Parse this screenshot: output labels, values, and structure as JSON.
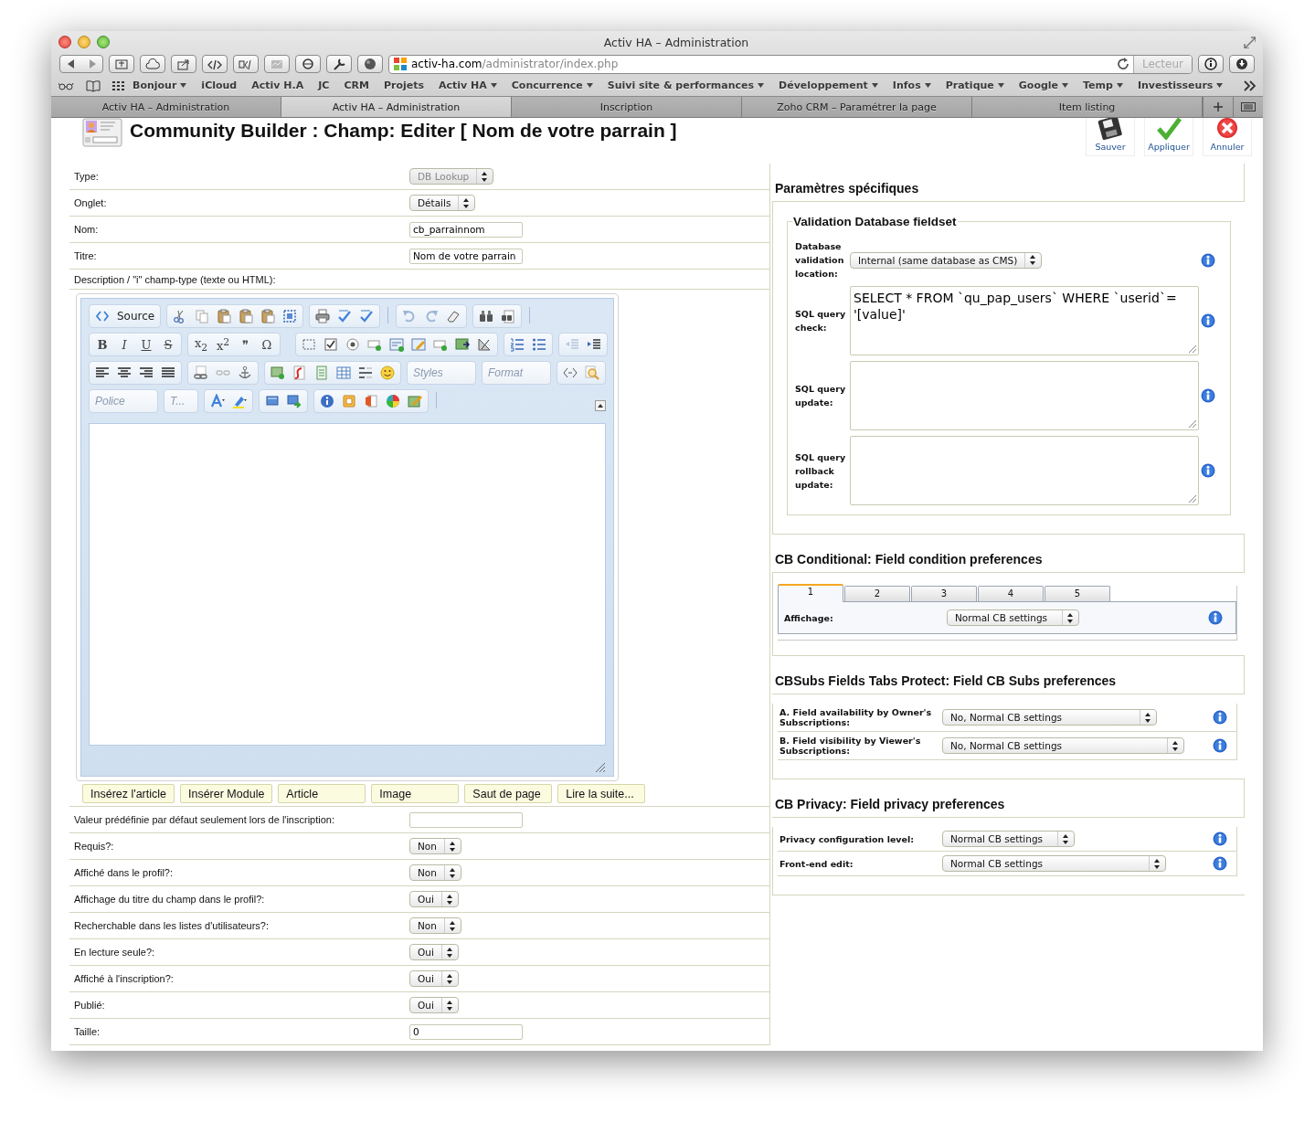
{
  "window": {
    "title": "Activ HA – Administration"
  },
  "address_bar": {
    "host": "activ-ha.com",
    "path": "/administrator/index.php",
    "reader_button": "Lecteur",
    "reader_enabled": false
  },
  "bookmarks": [
    {
      "label": "Bonjour",
      "menu": true
    },
    {
      "label": "iCloud",
      "menu": false
    },
    {
      "label": "Activ H.A",
      "menu": false
    },
    {
      "label": "JC",
      "menu": false
    },
    {
      "label": "CRM",
      "menu": false
    },
    {
      "label": "Projets",
      "menu": false
    },
    {
      "label": "Activ HA",
      "menu": true
    },
    {
      "label": "Concurrence",
      "menu": true
    },
    {
      "label": "Suivi site & performances",
      "menu": true
    },
    {
      "label": "Développement",
      "menu": true
    },
    {
      "label": "Infos",
      "menu": true
    },
    {
      "label": "Pratique",
      "menu": true
    },
    {
      "label": "Google",
      "menu": true
    },
    {
      "label": "Temp",
      "menu": true
    },
    {
      "label": "Investisseurs",
      "menu": true
    }
  ],
  "tabs": [
    {
      "label": "Activ HA – Administration",
      "selected": false
    },
    {
      "label": "Activ HA – Administration",
      "selected": true
    },
    {
      "label": "Inscription",
      "selected": false
    },
    {
      "label": "Zoho CRM – Paramétrer la page",
      "selected": false
    },
    {
      "label": "Item listing",
      "selected": false
    }
  ],
  "page": {
    "title": "Community Builder : Champ: Editer [ Nom de votre parrain ]",
    "actions": [
      {
        "label": "Sauver",
        "kind": "save"
      },
      {
        "label": "Appliquer",
        "kind": "apply"
      },
      {
        "label": "Annuler",
        "kind": "cancel"
      }
    ]
  },
  "fields": [
    {
      "label": "Type:",
      "kind": "select",
      "value": "DB Lookup",
      "disabled": true
    },
    {
      "label": "Onglet:",
      "kind": "select",
      "value": "Détails",
      "disabled": false
    },
    {
      "label": "Nom:",
      "kind": "input",
      "value": "cb_parrainnom"
    },
    {
      "label": "Titre:",
      "kind": "input",
      "value": "Nom de votre parrain"
    },
    {
      "label": "Description / \"i\" champ-type (texte ou HTML):",
      "kind": "heading"
    }
  ],
  "editor": {
    "source_label": "Source",
    "format_letters": [
      "B",
      "I",
      "U",
      "S"
    ],
    "script_buttons": [
      "x$_{2}$",
      "x$^{2}$"
    ],
    "quote_glyph": "❞",
    "omega_glyph": "Ω",
    "styles_placeholder": "Styles",
    "format_placeholder": "Format",
    "font_placeholder": "Police",
    "size_placeholder": "T...",
    "insert_buttons": [
      "Insérez l'article",
      "Insérer Module",
      "Article",
      "Image",
      "Saut de page",
      "Lire la suite..."
    ]
  },
  "fields_after": [
    {
      "label": "Valeur prédéfinie par défaut seulement lors de l'inscription:",
      "kind": "input"
    },
    {
      "label": "Requis?:",
      "kind": "select",
      "value": "Non",
      "disabled": false
    },
    {
      "label": "Affiché dans le profil?:",
      "kind": "select",
      "value": "Non",
      "disabled": false
    },
    {
      "label": "Affichage du titre du champ dans le profil?:",
      "kind": "select",
      "value": "Oui",
      "disabled": false
    },
    {
      "label": "Recherchable dans les listes d'utilisateurs?:",
      "kind": "select",
      "value": "Non",
      "disabled": false
    },
    {
      "label": "En lecture seule?:",
      "kind": "select",
      "value": "Oui",
      "disabled": false
    },
    {
      "label": "Affiché à l'inscription?:",
      "kind": "select",
      "value": "Oui",
      "disabled": false
    },
    {
      "label": "Publié:",
      "kind": "select",
      "value": "Oui",
      "disabled": false
    },
    {
      "label": "Taille:",
      "kind": "input",
      "value": "0"
    }
  ],
  "sections": [
    {
      "kind": "fieldset",
      "title": "Paramètres spécifiques",
      "legend": "Validation Database fieldset",
      "rows": [
        {
          "label": "Database validation location:",
          "kind": "select",
          "value": "Internal (same database as CMS)"
        },
        {
          "label": "SQL query check:",
          "kind": "textarea",
          "value": "SELECT * FROM `qu_pap_users` WHERE `userid`= '[value]'"
        },
        {
          "label": "SQL query update:",
          "kind": "textarea"
        },
        {
          "label": "SQL query rollback update:",
          "kind": "textarea"
        }
      ]
    },
    {
      "kind": "tabs",
      "title": "CB Conditional: Field condition preferences",
      "tabs": [
        {
          "label": "1",
          "selected": true
        },
        {
          "label": "2",
          "selected": false
        },
        {
          "label": "3",
          "selected": false
        },
        {
          "label": "4",
          "selected": false
        },
        {
          "label": "5",
          "selected": false
        }
      ],
      "rows": [
        {
          "label": "Affichage:",
          "kind": "select",
          "value": "Normal CB settings"
        }
      ]
    },
    {
      "kind": "rows",
      "title": "CBSubs Fields Tabs Protect: Field CB Subs preferences",
      "rows": [
        {
          "label": "A. Field availability by Owner's Subscriptions:",
          "kind": "select",
          "value": "No, Normal CB settings"
        },
        {
          "label": "B. Field visibility by Viewer's Subscriptions:",
          "kind": "select",
          "value": "No, Normal CB settings"
        }
      ]
    },
    {
      "kind": "rows",
      "title": "CB Privacy: Field privacy preferences",
      "rows": [
        {
          "label": "Privacy configuration level:",
          "kind": "select",
          "value": "Normal CB settings"
        },
        {
          "label": "Front-end edit:",
          "kind": "select",
          "value": "Normal CB settings"
        }
      ]
    }
  ]
}
